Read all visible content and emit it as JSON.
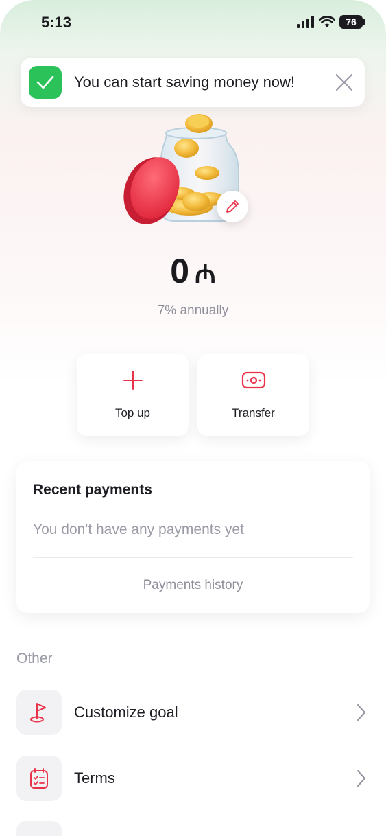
{
  "status_bar": {
    "time": "5:13",
    "battery": "76"
  },
  "toast": {
    "message": "You can start saving money now!"
  },
  "balance": {
    "amount": "0",
    "currency": "₼",
    "rate": "7% annually"
  },
  "actions": [
    {
      "label": "Top up",
      "icon": "plus-icon"
    },
    {
      "label": "Transfer",
      "icon": "money-icon"
    }
  ],
  "recent_payments": {
    "title": "Recent payments",
    "empty_text": "You don't have any payments yet",
    "history_link": "Payments history"
  },
  "other": {
    "title": "Other",
    "items": [
      {
        "label": "Customize goal",
        "icon": "flag-icon"
      },
      {
        "label": "Terms",
        "icon": "checklist-icon"
      }
    ]
  },
  "colors": {
    "accent": "#e8334a",
    "success": "#2cc25a"
  }
}
